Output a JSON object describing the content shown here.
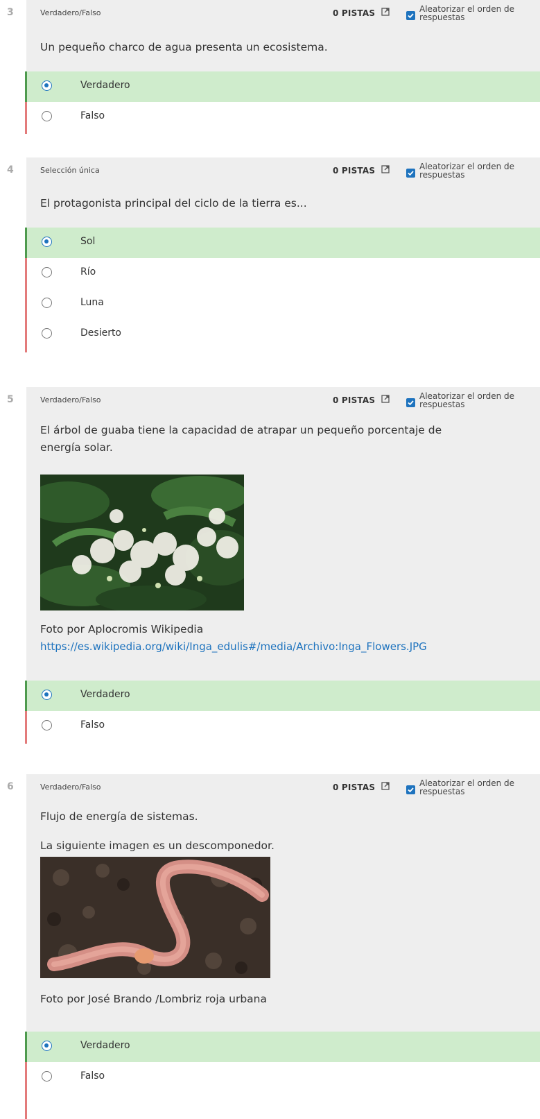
{
  "common": {
    "hints_label": "0 PISTAS",
    "randomize_label": "Aleatorizar el orden de respuestas"
  },
  "colors": {
    "accent": "#1e73be",
    "correct_bg": "#cfeccc",
    "correct_bar": "#4e9a4e",
    "wrong_bar": "#e37b7b",
    "card_bg": "#eeeeee"
  },
  "questions": [
    {
      "number": "3",
      "type": "Verdadero/Falso",
      "text": "Un pequeño charco de agua presenta un ecosistema.",
      "answers": [
        {
          "label": "Verdadero",
          "selected": true
        },
        {
          "label": "Falso",
          "selected": false
        }
      ]
    },
    {
      "number": "4",
      "type": "Selección única",
      "text": "El protagonista principal del ciclo de la tierra es...",
      "answers": [
        {
          "label": "Sol",
          "selected": true
        },
        {
          "label": "Río",
          "selected": false
        },
        {
          "label": "Luna",
          "selected": false
        },
        {
          "label": "Desierto",
          "selected": false
        }
      ]
    },
    {
      "number": "5",
      "type": "Verdadero/Falso",
      "text_line1": "El árbol de guaba tiene la capacidad de atrapar un pequeño porcentaje de",
      "text_line2": "energía solar.",
      "credit": "Foto por Aplocromis Wikipedia",
      "link": "https://es.wikipedia.org/wiki/Inga_edulis#/media/Archivo:Inga_Flowers.JPG",
      "answers": [
        {
          "label": "Verdadero",
          "selected": true
        },
        {
          "label": "Falso",
          "selected": false
        }
      ]
    },
    {
      "number": "6",
      "type": "Verdadero/Falso",
      "text": "Flujo de energía de sistemas.",
      "text2": "La siguiente imagen es un descomponedor.",
      "credit": "Foto por José Brando /Lombriz roja urbana",
      "answers": [
        {
          "label": "Verdadero",
          "selected": true
        },
        {
          "label": "Falso",
          "selected": false
        }
      ]
    }
  ]
}
